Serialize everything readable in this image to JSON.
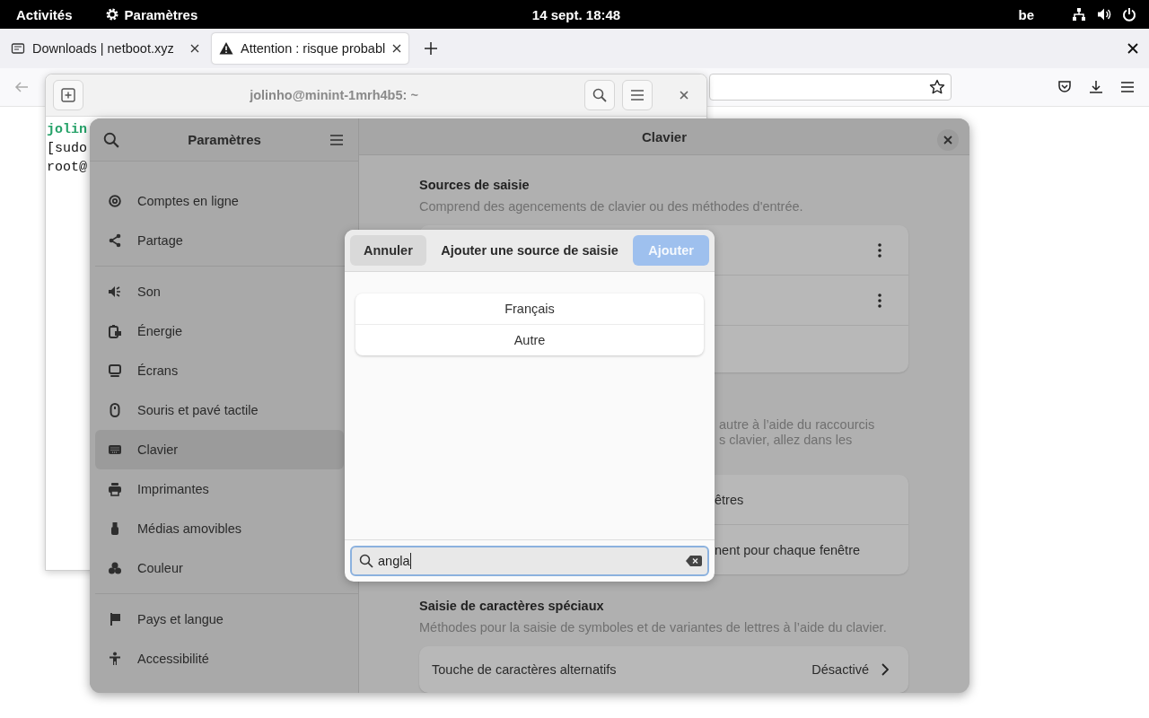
{
  "top_bar": {
    "activities": "Activités",
    "app_menu": "Paramètres",
    "clock": "14 sept.  18:48",
    "keyboard_layout": "be"
  },
  "browser": {
    "tabs": [
      {
        "label": "Downloads | netboot.xyz",
        "selected": false,
        "kind": "page"
      },
      {
        "label": "Attention : risque probabl",
        "selected": true,
        "kind": "warning"
      }
    ]
  },
  "terminal": {
    "title": "jolinho@minint-1mrh4b5: ~",
    "lines": [
      {
        "text": "jolin",
        "kind": "prompt"
      },
      {
        "text": "[sudo",
        "kind": "plain"
      },
      {
        "text": "root@",
        "kind": "plain"
      }
    ]
  },
  "settings": {
    "title": "Paramètres",
    "sidebar": {
      "groups": [
        {
          "items": [
            {
              "label": "Comptes en ligne",
              "selected": false
            },
            {
              "label": "Partage",
              "selected": false
            }
          ]
        },
        {
          "items": [
            {
              "label": "Son",
              "selected": false
            },
            {
              "label": "Énergie",
              "selected": false
            },
            {
              "label": "Écrans",
              "selected": false
            },
            {
              "label": "Souris et pavé tactile",
              "selected": false
            },
            {
              "label": "Clavier",
              "selected": true
            },
            {
              "label": "Imprimantes",
              "selected": false
            },
            {
              "label": "Médias amovibles",
              "selected": false
            },
            {
              "label": "Couleur",
              "selected": false
            }
          ]
        },
        {
          "items": [
            {
              "label": "Pays et langue",
              "selected": false
            },
            {
              "label": "Accessibilité",
              "selected": false
            }
          ]
        }
      ]
    },
    "panel": {
      "title": "Clavier",
      "input_sources": {
        "heading": "Sources de saisie",
        "description": "Comprend des agencements de clavier ou des méthodes d'entrée.",
        "rows": [
          {
            "kind": "source"
          },
          {
            "kind": "source"
          },
          {
            "kind": "blank"
          }
        ]
      },
      "switching": {
        "description_lines": [
          "autre à l’aide du raccourcis",
          "s clavier, allez dans les"
        ],
        "rows": [
          "êtres",
          "nent pour chaque fenêtre"
        ]
      },
      "special_chars": {
        "heading": "Saisie de caractères spéciaux",
        "description": "Méthodes pour la saisie de symboles et de variantes de lettres à l’aide du clavier.",
        "rows": [
          {
            "label": "Touche de caractères alternatifs",
            "value": "Désactivé"
          }
        ]
      }
    }
  },
  "dialog": {
    "cancel": "Annuler",
    "title": "Ajouter une source de saisie",
    "add": {
      "label": "Ajouter",
      "disabled": true
    },
    "options": [
      "Français",
      "Autre"
    ],
    "search": {
      "value": "angla"
    }
  }
}
